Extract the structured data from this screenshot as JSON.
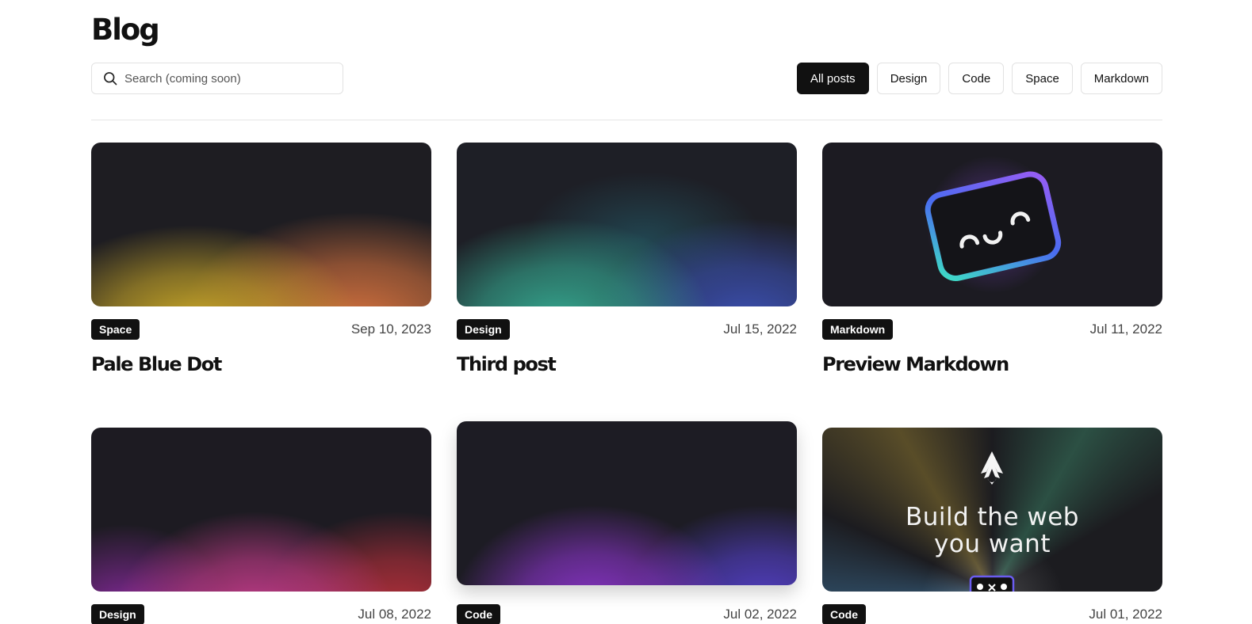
{
  "page": {
    "title": "Blog"
  },
  "search": {
    "placeholder": "Search (coming soon)"
  },
  "filters": [
    {
      "label": "All posts",
      "active": true
    },
    {
      "label": "Design",
      "active": false
    },
    {
      "label": "Code",
      "active": false
    },
    {
      "label": "Space",
      "active": false
    },
    {
      "label": "Markdown",
      "active": false
    }
  ],
  "posts": [
    {
      "tag": "Space",
      "date": "Sep 10, 2023",
      "title": "Pale Blue Dot",
      "cover": "yellow-orange-gradient"
    },
    {
      "tag": "Design",
      "date": "Jul 15, 2022",
      "title": "Third post",
      "cover": "teal-blue-gradient"
    },
    {
      "tag": "Markdown",
      "date": "Jul 11, 2022",
      "title": "Preview Markdown",
      "cover": "smiling-card-illustration"
    },
    {
      "tag": "Design",
      "date": "Jul 08, 2022",
      "title": "",
      "cover": "magenta-red-gradient"
    },
    {
      "tag": "Code",
      "date": "Jul 02, 2022",
      "title": "",
      "cover": "purple-violet-gradient"
    },
    {
      "tag": "Code",
      "date": "Jul 01, 2022",
      "title": "",
      "cover": "astro-build-the-web-banner",
      "cover_text": [
        "Build the web",
        "you want"
      ]
    }
  ],
  "colors": {
    "accent": "#111111",
    "border": "#e2e2e2",
    "text_muted": "#444444"
  },
  "icons": {
    "search": "search-icon",
    "logo": "astro-logo-icon"
  }
}
